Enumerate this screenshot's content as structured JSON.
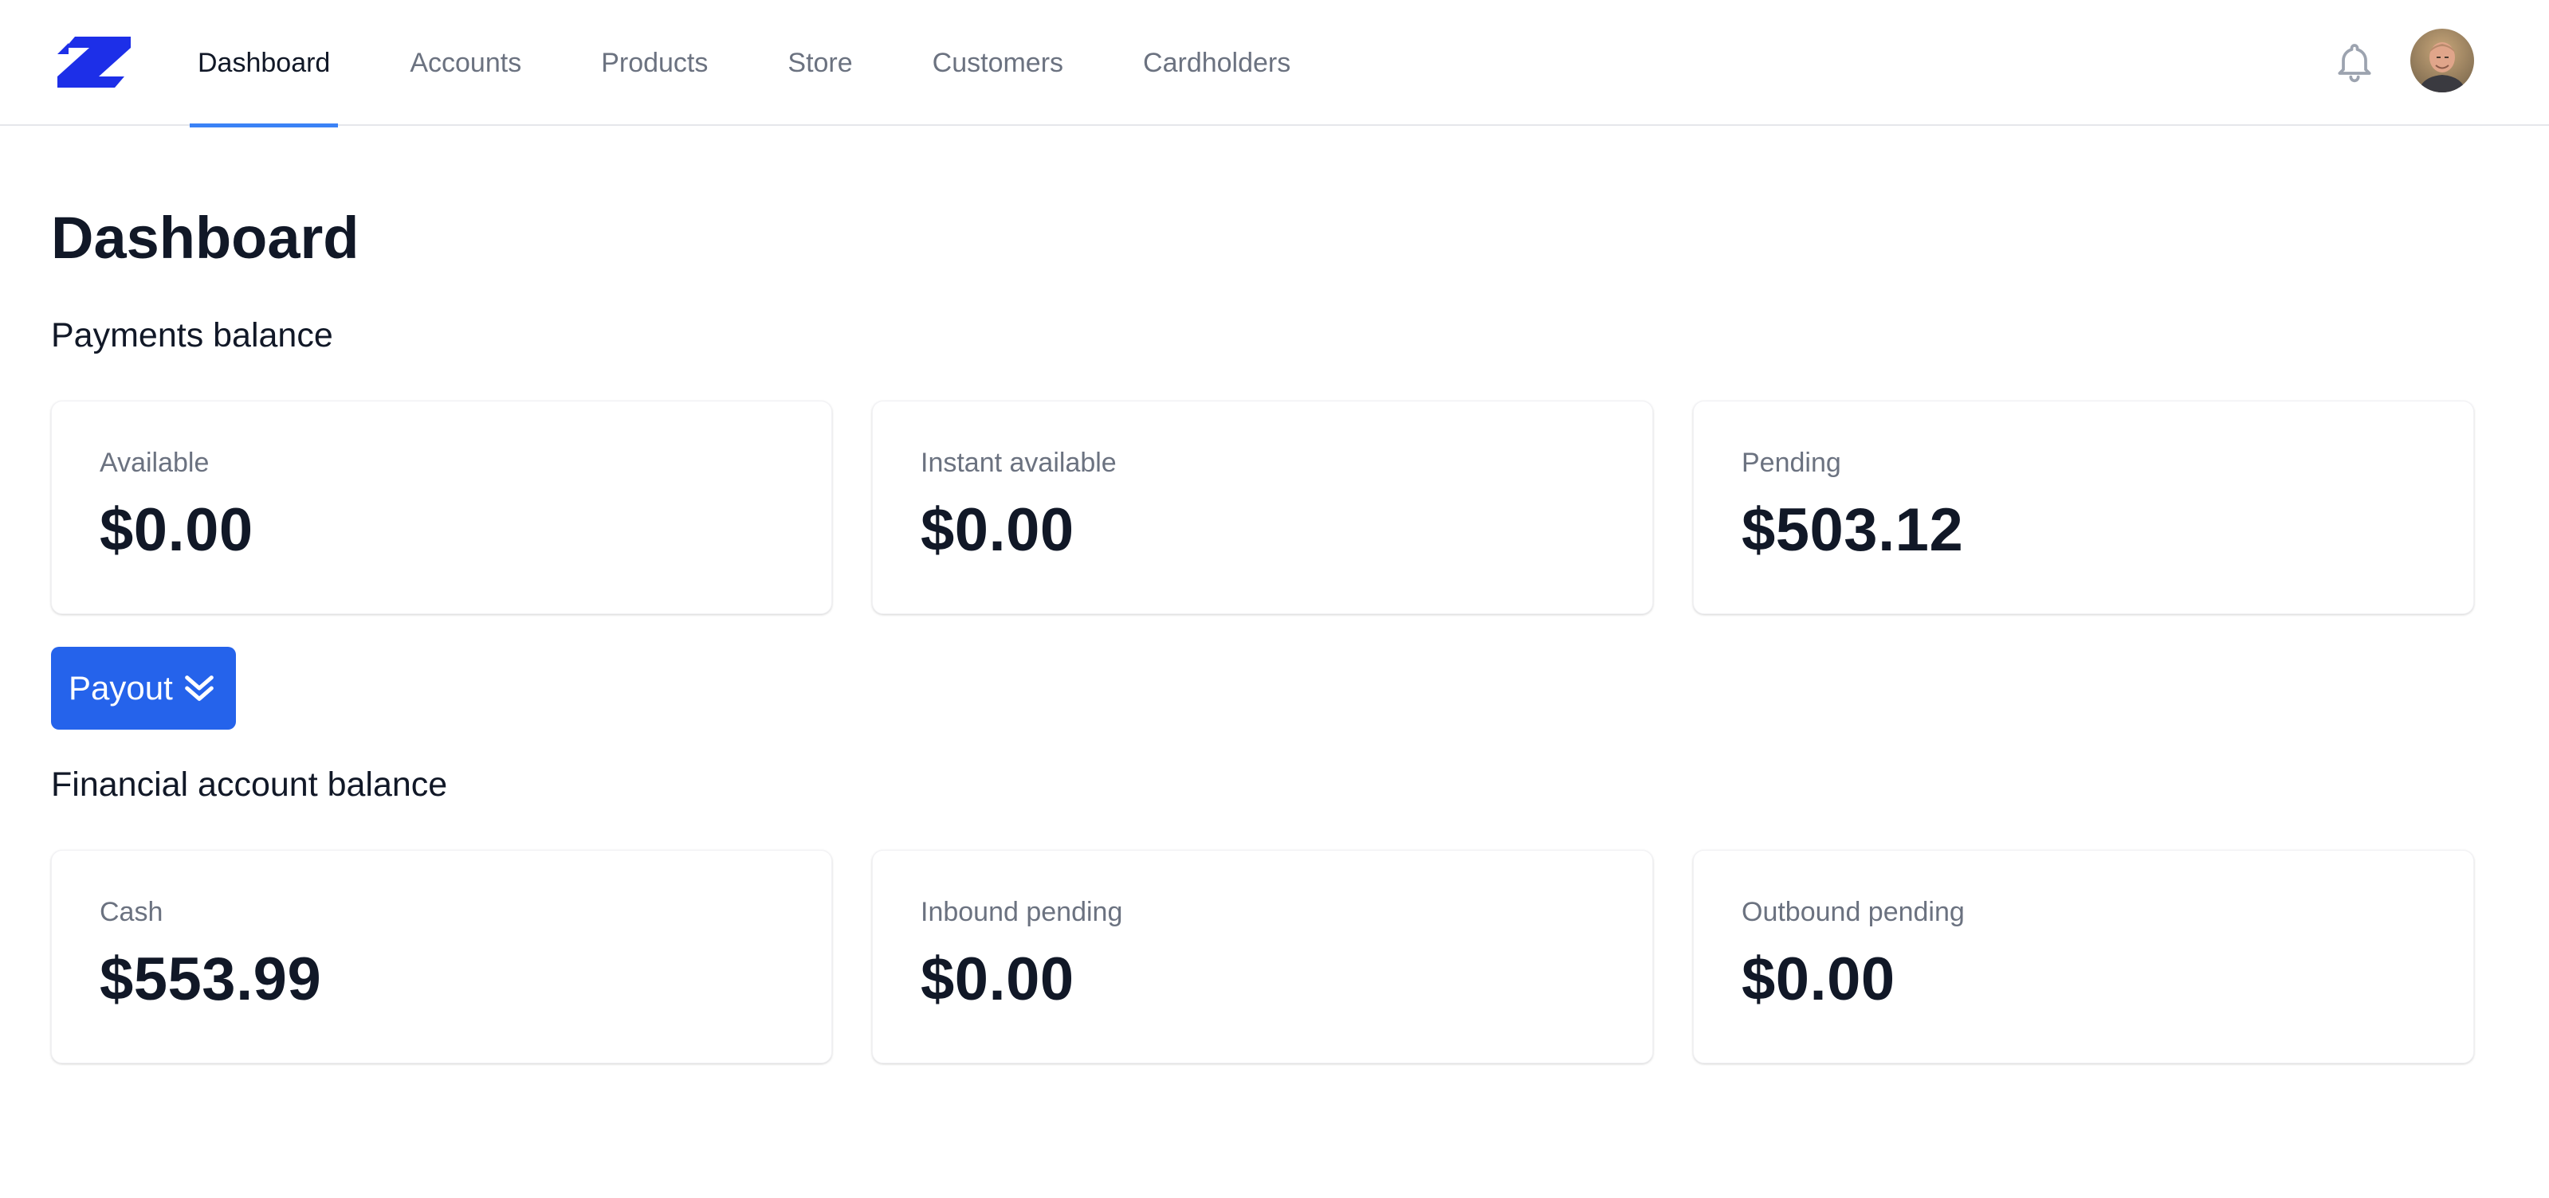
{
  "nav": {
    "items": [
      {
        "label": "Dashboard",
        "active": true
      },
      {
        "label": "Accounts",
        "active": false
      },
      {
        "label": "Products",
        "active": false
      },
      {
        "label": "Store",
        "active": false
      },
      {
        "label": "Customers",
        "active": false
      },
      {
        "label": "Cardholders",
        "active": false
      }
    ],
    "bell_icon": "bell-icon",
    "logo_icon": "z-logo-icon"
  },
  "page": {
    "title": "Dashboard"
  },
  "payments": {
    "title": "Payments balance",
    "cards": [
      {
        "label": "Available",
        "value": "$0.00"
      },
      {
        "label": "Instant available",
        "value": "$0.00"
      },
      {
        "label": "Pending",
        "value": "$503.12"
      }
    ],
    "payout_label": "Payout",
    "payout_icon": "double-chevron-down-icon"
  },
  "financial": {
    "title": "Financial account balance",
    "cards": [
      {
        "label": "Cash",
        "value": "$553.99"
      },
      {
        "label": "Inbound pending",
        "value": "$0.00"
      },
      {
        "label": "Outbound pending",
        "value": "$0.00"
      }
    ]
  },
  "colors": {
    "accent": "#2563eb",
    "active_underline": "#3b82f6",
    "logo": "#1d2fe8"
  }
}
